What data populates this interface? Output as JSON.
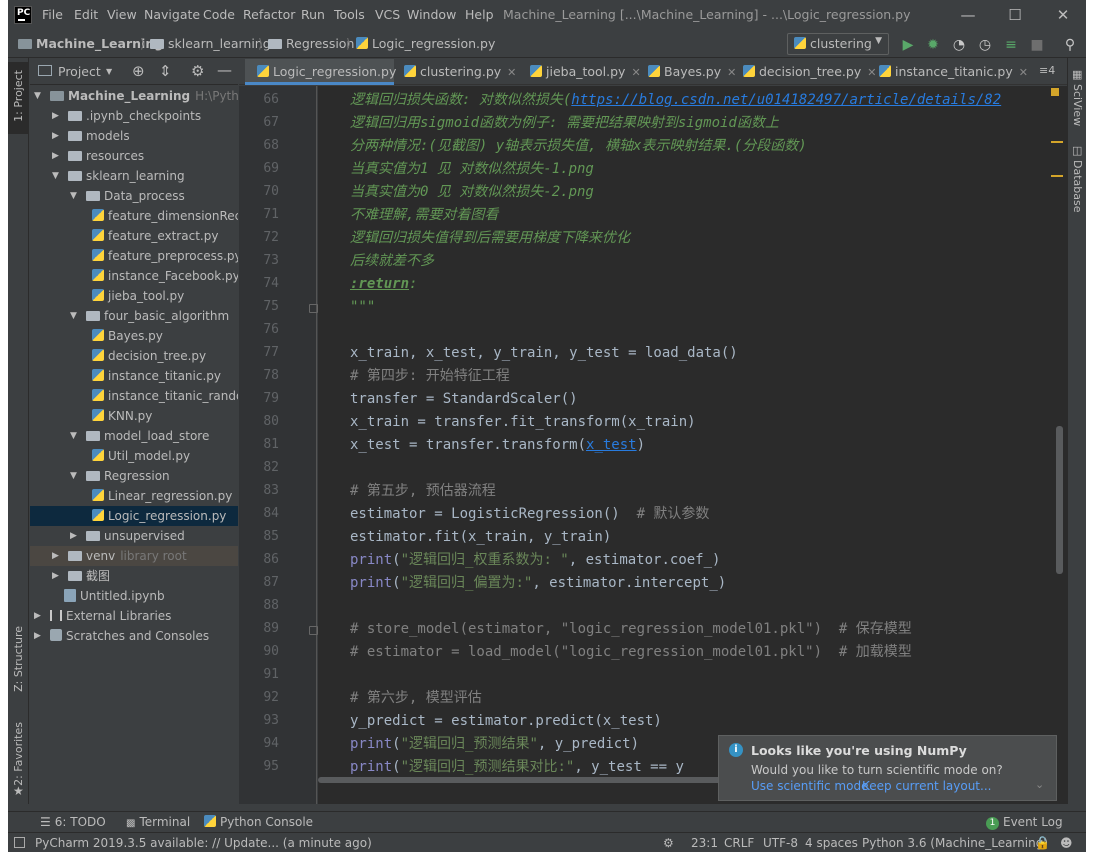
{
  "window": {
    "title": "Machine_Learning [...\\Machine_Learning] - ...\\Logic_regression.py",
    "logo_text": "PC",
    "menu": [
      "File",
      "Edit",
      "View",
      "Navigate",
      "Code",
      "Refactor",
      "Run",
      "Tools",
      "VCS",
      "Window",
      "Help"
    ]
  },
  "breadcrumb": [
    "Machine_Learning",
    "sklearn_learning",
    "Regression",
    "Logic_regression.py"
  ],
  "run_config": "clustering",
  "project_panel": {
    "title": "Project"
  },
  "tree": [
    {
      "label": "Machine_Learning",
      "extra": "H:\\Python_p",
      "type": "folder",
      "bold": true
    },
    {
      "label": ".ipynb_checkpoints",
      "type": "folder"
    },
    {
      "label": "models",
      "type": "folder"
    },
    {
      "label": "resources",
      "type": "folder"
    },
    {
      "label": "sklearn_learning",
      "type": "folder"
    },
    {
      "label": "Data_process",
      "type": "folder"
    },
    {
      "label": "feature_dimensionRec",
      "type": "py"
    },
    {
      "label": "feature_extract.py",
      "type": "py"
    },
    {
      "label": "feature_preprocess.py",
      "type": "py"
    },
    {
      "label": "instance_Facebook.py",
      "type": "py"
    },
    {
      "label": "jieba_tool.py",
      "type": "py"
    },
    {
      "label": "four_basic_algorithm",
      "type": "folder"
    },
    {
      "label": "Bayes.py",
      "type": "py"
    },
    {
      "label": "decision_tree.py",
      "type": "py"
    },
    {
      "label": "instance_titanic.py",
      "type": "py"
    },
    {
      "label": "instance_titanic_rando",
      "type": "py"
    },
    {
      "label": "KNN.py",
      "type": "py"
    },
    {
      "label": "model_load_store",
      "type": "folder"
    },
    {
      "label": "Util_model.py",
      "type": "py"
    },
    {
      "label": "Regression",
      "type": "folder"
    },
    {
      "label": "Linear_regression.py",
      "type": "py"
    },
    {
      "label": "Logic_regression.py",
      "type": "py",
      "selected": true
    },
    {
      "label": "unsupervised",
      "type": "folder"
    },
    {
      "label": "venv",
      "extra": "library root",
      "type": "folder"
    },
    {
      "label": "截图",
      "type": "folder"
    },
    {
      "label": "Untitled.ipynb",
      "type": "nb"
    },
    {
      "label": "External Libraries",
      "type": "lib"
    },
    {
      "label": "Scratches and Consoles",
      "type": "scratch"
    }
  ],
  "editor_tabs": [
    {
      "label": "Logic_regression.py",
      "active": true
    },
    {
      "label": "clustering.py"
    },
    {
      "label": "jieba_tool.py"
    },
    {
      "label": "Bayes.py"
    },
    {
      "label": "decision_tree.py"
    },
    {
      "label": "instance_titanic.py"
    }
  ],
  "tabs_overflow": "≡4",
  "line_numbers": [
    "66",
    "67",
    "68",
    "69",
    "70",
    "71",
    "72",
    "73",
    "74",
    "75",
    "76",
    "77",
    "78",
    "79",
    "80",
    "81",
    "82",
    "83",
    "84",
    "85",
    "86",
    "87",
    "88",
    "89",
    "90",
    "91",
    "92",
    "93",
    "94",
    "95"
  ],
  "code": {
    "l66a": "逻辑回归损失函数: 对数似然损失(",
    "l66b": "https://blog.csdn.net/u014182497/article/details/82",
    "l67": "逻辑回归用sigmoid函数为例子: 需要把结果映射到sigmoid函数上",
    "l68": "分两种情况:(见截图) y轴表示损失值, 横轴x表示映射结果.(分段函数)",
    "l69": "当真实值为1 见 对数似然损失-1.png",
    "l70": "当真实值为0 见 对数似然损失-2.png",
    "l71": "不难理解,需要对着图看",
    "l72": "逻辑回归损失值得到后需要用梯度下降来优化",
    "l73": "后续就差不多",
    "l74": ":return",
    "l74b": ":",
    "l75": "\"\"\"",
    "l77": "x_train, x_test, y_train, y_test = load_data()",
    "l78": "# 第四步: 开始特征工程",
    "l79": "transfer = StandardScaler()",
    "l80": "x_train = transfer.fit_transform(x_train)",
    "l81a": "x_test = transfer.transform(",
    "l81b": "x_test",
    "l81c": ")",
    "l83": "# 第五步, 预估器流程",
    "l84a": "estimator = LogisticRegression()  ",
    "l84b": "# 默认参数",
    "l85": "estimator.fit(x_train, y_train)",
    "l86a": "print",
    "l86b": "(",
    "l86c": "\"逻辑回归_权重系数为: \"",
    "l86d": ", estimator.coef_)",
    "l87a": "print",
    "l87b": "(",
    "l87c": "\"逻辑回归_偏置为:\"",
    "l87d": ", estimator.intercept_)",
    "l89": "# store_model(estimator, \"logic_regression_model01.pkl\")  # 保存模型",
    "l90": "# estimator = load_model(\"logic_regression_model01.pkl\")  # 加载模型",
    "l92": "# 第六步, 模型评估",
    "l93": "y_predict = estimator.predict(x_test)",
    "l94a": "print",
    "l94b": "(",
    "l94c": "\"逻辑回归_预测结果\"",
    "l94d": ", y_predict)",
    "l95a": "print",
    "l95b": "(",
    "l95c": "\"逻辑回归_预测结果对比:\"",
    "l95d": ", y_test == y"
  },
  "right_stripe": [
    "SciView",
    "Database"
  ],
  "left_stripe": [
    "1: Project",
    "Z: Structure",
    "2: Favorites"
  ],
  "notification": {
    "title": "Looks like you're using NumPy",
    "body": "Would you like to turn scientific mode on?",
    "link1": "Use scientific mode",
    "link2": "Keep current layout..."
  },
  "tool_windows": {
    "todo": "6: TODO",
    "terminal": "Terminal",
    "console": "Python Console",
    "event_log": "Event Log",
    "event_count": "1"
  },
  "status": {
    "message": "PyCharm 2019.3.5 available: // Update... (a minute ago)",
    "position": "23:1",
    "line_sep": "CRLF",
    "encoding": "UTF-8",
    "indent": "4 spaces",
    "interpreter": "Python 3.6 (Machine_Learning)"
  },
  "colors": {
    "background": "#2b2b2b",
    "panel": "#3c3f41",
    "accent": "#4a88c7",
    "docstring": "#629755",
    "string": "#6a8759"
  }
}
